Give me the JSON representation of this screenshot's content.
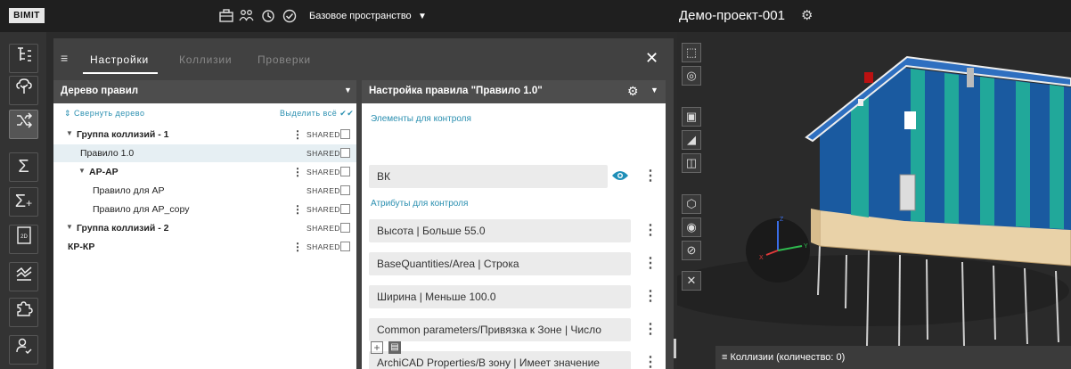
{
  "app": {
    "logo": "BIMIT",
    "space_selector": "Базовое пространство",
    "project_name": "Демо-проект-001"
  },
  "colors": {
    "accent": "#2a8fb0",
    "toolbar_bg": "#1f1f1f",
    "panel_bg": "#414141",
    "selected_row": "#e6eff3"
  },
  "panel": {
    "tabs": [
      "Настройки",
      "Коллизии",
      "Проверки"
    ],
    "active_tab": "Настройки"
  },
  "tree": {
    "title": "Дерево правил",
    "collapse_label": "Свернуть дерево",
    "select_all_label": "Выделить всё",
    "rows": [
      {
        "label": "Группа коллизий - 1",
        "level": 0,
        "expandable": true,
        "bold": true,
        "menu": true,
        "shared": "SHARED",
        "selected": false
      },
      {
        "label": "Правило 1.0",
        "level": 1,
        "expandable": false,
        "bold": false,
        "menu": false,
        "shared": "SHARED",
        "selected": true
      },
      {
        "label": "АР-АР",
        "level": 1,
        "expandable": true,
        "bold": true,
        "menu": true,
        "shared": "SHARED",
        "selected": false
      },
      {
        "label": "Правило для АР",
        "level": 2,
        "expandable": false,
        "bold": false,
        "menu": false,
        "shared": "SHARED",
        "selected": false
      },
      {
        "label": "Правило для АР_copy",
        "level": 2,
        "expandable": false,
        "bold": false,
        "menu": true,
        "shared": "SHARED",
        "selected": false
      },
      {
        "label": "Группа коллизий - 2",
        "level": 0,
        "expandable": true,
        "bold": true,
        "menu": false,
        "shared": "SHARED",
        "selected": false
      },
      {
        "label": "КР-КР",
        "level": 0,
        "expandable": false,
        "bold": true,
        "menu": true,
        "shared": "SHARED",
        "selected": false
      }
    ]
  },
  "rule": {
    "title": "Настройка правила \"Правило 1.0\"",
    "elements_label": "Элементы для контроля",
    "elements_value": "ВК",
    "attributes_label": "Атрибуты для контроля",
    "attributes": [
      "Высота | Больше 55.0",
      "BaseQuantities/Area | Строка",
      "Ширина | Меньше 100.0",
      "Common parameters/Привязка к Зоне | Число",
      "ArchiCAD Properties/В зону | Имеет значение"
    ]
  },
  "viewport": {
    "collisions_label": "Коллизии (количество: 0)",
    "axes": {
      "x": "X",
      "y": "Y",
      "z": "Z"
    }
  }
}
